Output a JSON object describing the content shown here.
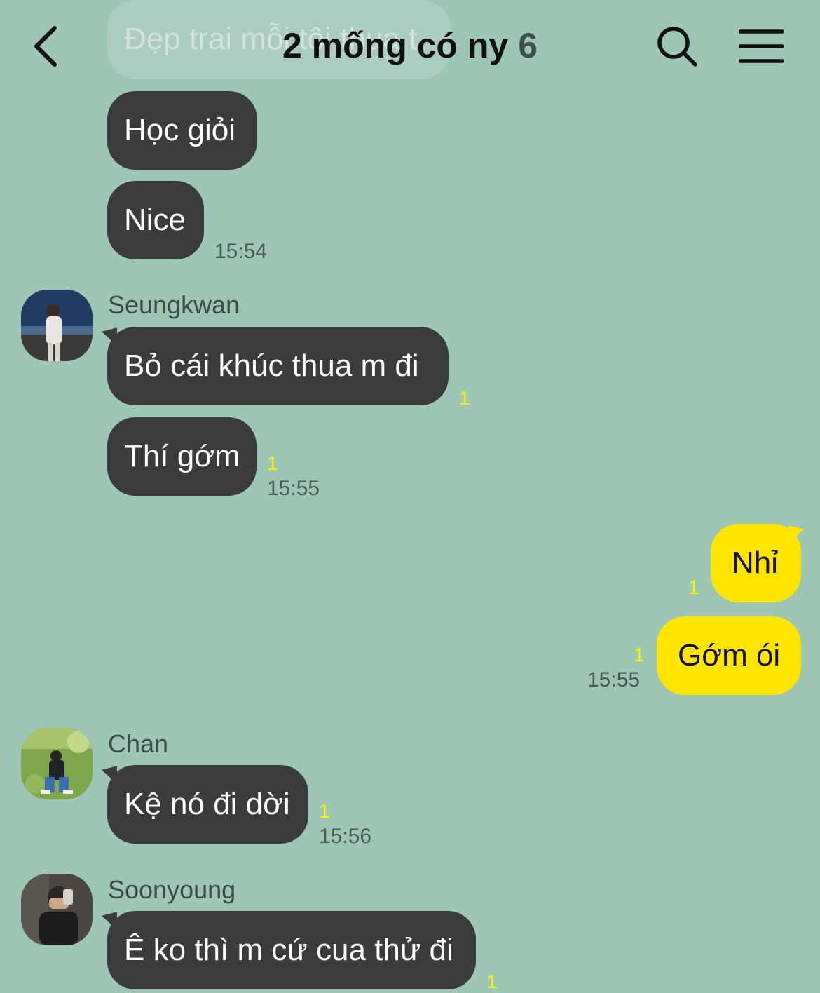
{
  "header": {
    "title": "2 mống có ny",
    "member_count": "6"
  },
  "messages": {
    "m0": {
      "text": "Đẹp trai mỗi tội thua t"
    },
    "m1": {
      "text": "Học giỏi"
    },
    "m2": {
      "text": "Nice",
      "time": "15:54"
    },
    "seungkwan": {
      "sender": "Seungkwan",
      "m3": {
        "text": "Bỏ cái khúc thua m đi",
        "unread": "1"
      },
      "m4": {
        "text": "Thí gớm",
        "unread": "1",
        "time": "15:55"
      }
    },
    "mine": {
      "m5": {
        "text": "Nhỉ",
        "unread": "1"
      },
      "m6": {
        "text": "Gớm ói",
        "unread": "1",
        "time": "15:55"
      }
    },
    "chan": {
      "sender": "Chan",
      "m7": {
        "text": "Kệ nó đi dời",
        "unread": "1",
        "time": "15:56"
      }
    },
    "soonyoung": {
      "sender": "Soonyoung",
      "m8": {
        "text": "Ê ko thì m cứ cua thử đi",
        "unread": "1"
      }
    }
  },
  "colors": {
    "background": "#9dc6b5",
    "bubble_dark": "#3a3b3d",
    "bubble_mine": "#fee500",
    "unread": "#fff200"
  },
  "icons": {
    "back": "chevron-left-icon",
    "search": "search-icon",
    "menu": "hamburger-menu-icon"
  }
}
